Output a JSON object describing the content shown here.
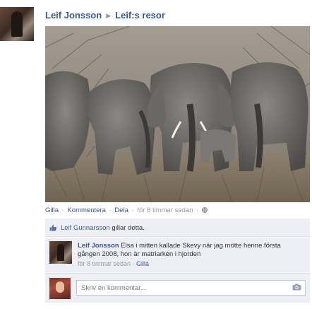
{
  "header": {
    "author": "Leif Jonsson",
    "album": "Leif:s resor"
  },
  "actions": {
    "like": "Gilla",
    "comment": "Kommentera",
    "share": "Dela",
    "time": "för 8 timmar sedan"
  },
  "likes": {
    "name": "Leif Gunnarsson",
    "text": " gillar detta."
  },
  "comment": {
    "author": "Leif Jonsson",
    "text": "Elsa i mitten kallade Skevy när jag mötte henne första gången 2008, hon är matriarken i hjorden",
    "time": "för 8 timmar sedan",
    "like": "Gilla"
  },
  "composer": {
    "placeholder": "Skriv en kommentar..."
  },
  "icons": {
    "separator_arrow": "triangle-right",
    "privacy": "globe-icon",
    "like": "thumbs-up-icon",
    "camera": "camera-icon"
  }
}
